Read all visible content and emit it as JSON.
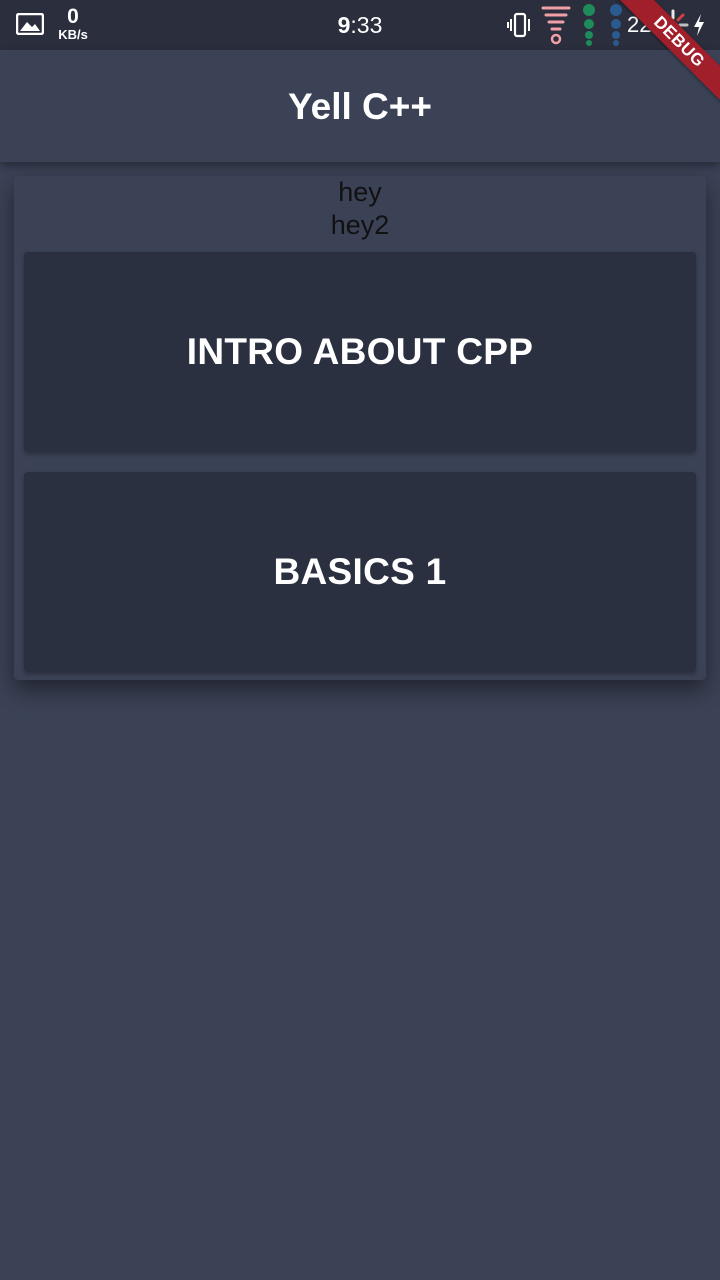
{
  "status_bar": {
    "speed_value": "0",
    "speed_unit": "KB/s",
    "time_hour": "9",
    "time_rest": ":33",
    "battery": "22",
    "icons": [
      "gallery-icon",
      "vibrate-icon",
      "wifi-icon",
      "signal-green-icon",
      "signal-blue-icon",
      "loading-spinner-icon",
      "charging-icon"
    ]
  },
  "debug_banner": "DEBUG",
  "appbar": {
    "title": "Yell C++"
  },
  "main": {
    "line1": "hey",
    "line2": "hey2",
    "cards": [
      {
        "label": "INTRO ABOUT CPP"
      },
      {
        "label": "BASICS 1"
      }
    ]
  },
  "colors": {
    "background": "#3b4256",
    "card": "#2b3040",
    "status_bar": "#2a2e3d",
    "debug": "#a01f2a"
  }
}
